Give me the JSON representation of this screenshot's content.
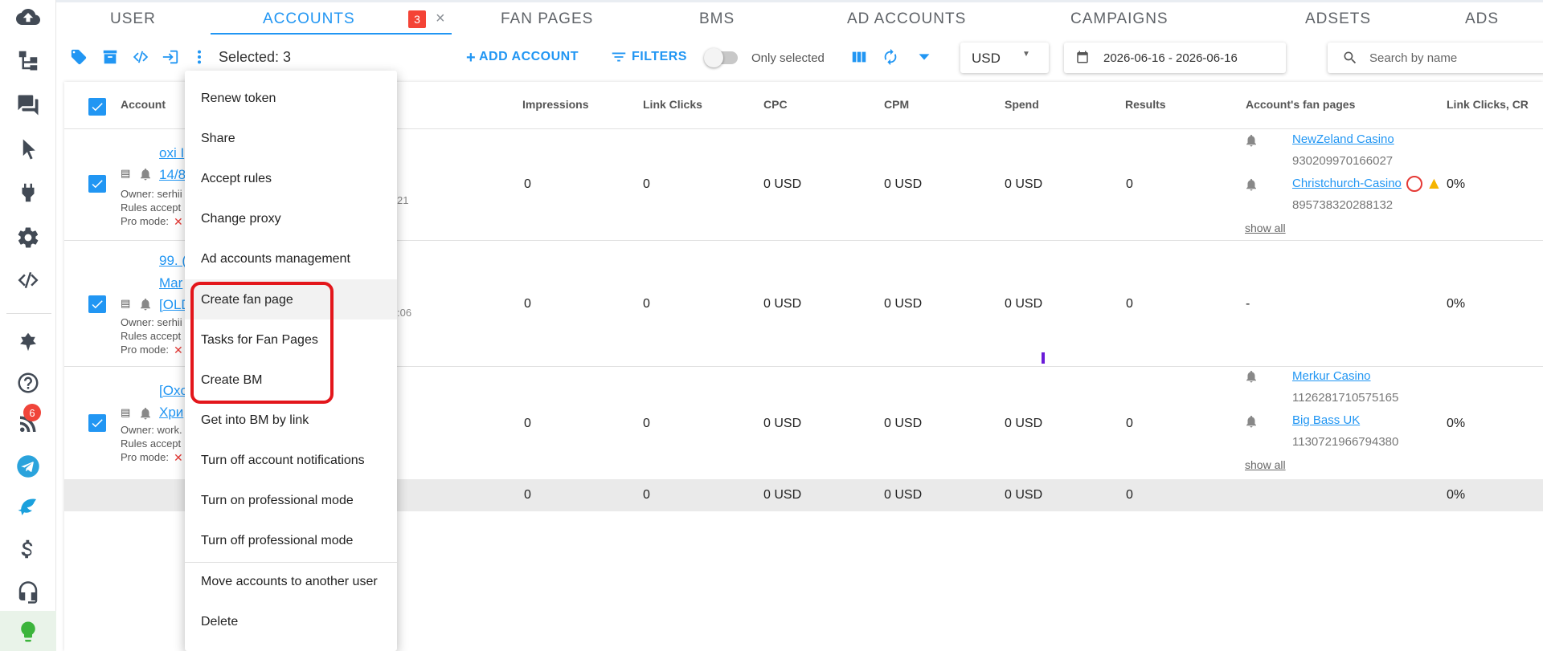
{
  "tabs": {
    "items": [
      {
        "label": "USER"
      },
      {
        "label": "ACCOUNTS"
      },
      {
        "label": "FAN PAGES"
      },
      {
        "label": "BMS"
      },
      {
        "label": "AD ACCOUNTS"
      },
      {
        "label": "CAMPAIGNS"
      },
      {
        "label": "ADSETS"
      },
      {
        "label": "ADS"
      }
    ],
    "accounts_badge": "3",
    "close_glyph": "×"
  },
  "sidebar": {
    "notifications_badge": "6",
    "icons": [
      "cloud-upload-icon",
      "hierarchy-icon",
      "chat-icon",
      "cursor-icon",
      "plug-icon",
      "gear-icon",
      "code-icon",
      "avatar-icon",
      "help-icon",
      "rss-icon",
      "telegram-icon",
      "dolphin-icon",
      "dollar-icon",
      "headset-icon",
      "lightbulb-icon"
    ]
  },
  "toolbar": {
    "selected_text": "Selected: 3",
    "add_account": "ADD ACCOUNT",
    "filters": "FILTERS",
    "only_selected": "Only selected",
    "currency": "USD",
    "date_range": "2026-06-16 - 2026-06-16",
    "search_placeholder": "Search by name"
  },
  "table": {
    "headers": {
      "account": "Account",
      "impressions": "Impressions",
      "link_clicks": "Link Clicks",
      "cpc": "CPC",
      "cpm": "CPM",
      "spend": "Spend",
      "results": "Results",
      "fan_pages": "Account's fan pages",
      "link_clicks_cr": "Link Clicks, CR"
    },
    "rows": [
      {
        "name_line1": "oxi I",
        "name_line2": "14/8",
        "owner": "Owner: serhii",
        "rules": "Rules accept",
        "pro_mode": "Pro mode:",
        "date_frag": "21",
        "impressions": "0",
        "link_clicks": "0",
        "cpc": "0 USD",
        "cpm": "0 USD",
        "spend": "0 USD",
        "results": "0",
        "fan_pages": [
          {
            "name": "NewZeland Casino",
            "id": "930209970166027"
          },
          {
            "name": "Christchurch-Casino",
            "id": "895738320288132"
          }
        ],
        "show_all": "show all",
        "cr": "0%"
      },
      {
        "name_line1": "99. (",
        "name_line2": "Mar",
        "name_line3": "[OLD",
        "owner": "Owner: serhii",
        "rules": "Rules accept",
        "pro_mode": "Pro mode:",
        "date_frag": ":06",
        "impressions": "0",
        "link_clicks": "0",
        "cpc": "0 USD",
        "cpm": "0 USD",
        "spend": "0 USD",
        "results": "0",
        "fan_pages_dash": "-",
        "cr": "0%"
      },
      {
        "name_line1": "[Oxo",
        "name_line2": "Хри",
        "owner": "Owner: work.",
        "rules": "Rules accept",
        "pro_mode": "Pro mode:",
        "impressions": "0",
        "link_clicks": "0",
        "cpc": "0 USD",
        "cpm": "0 USD",
        "spend": "0 USD",
        "results": "0",
        "fan_pages": [
          {
            "name": "Merkur Casino",
            "id": "1126281710575165"
          },
          {
            "name": "Big Bass UK",
            "id": "1130721966794380"
          }
        ],
        "show_all": "show all",
        "cr": "0%"
      }
    ],
    "totals": {
      "impressions": "0",
      "link_clicks": "0",
      "cpc": "0 USD",
      "cpm": "0 USD",
      "spend": "0 USD",
      "results": "0",
      "cr": "0%"
    },
    "x_glyph": "✕"
  },
  "menu": {
    "items": [
      "Renew token",
      "Share",
      "Accept rules",
      "Change proxy",
      "Ad accounts management",
      "Create fan page",
      "Tasks for Fan Pages",
      "Create BM",
      "Get into BM by link",
      "Turn off account notifications",
      "Turn on professional mode",
      "Turn off professional mode",
      "Move accounts to another user",
      "Delete"
    ]
  },
  "colors": {
    "accent": "#2196f3",
    "badge": "#f44336",
    "highlight_frame": "#e3161b"
  }
}
